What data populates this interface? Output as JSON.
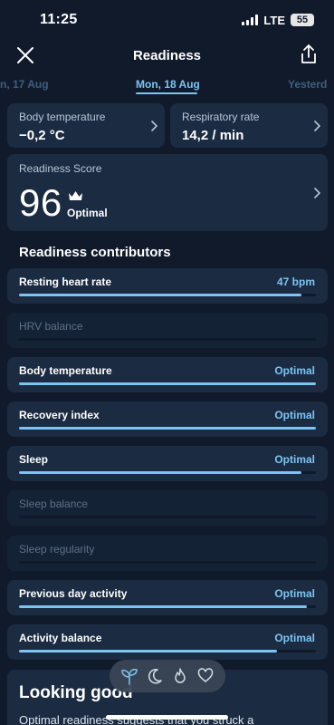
{
  "status_bar": {
    "time": "11:25",
    "network": "LTE",
    "battery": "55"
  },
  "header": {
    "title": "Readiness"
  },
  "dates": {
    "previous": "n, 17 Aug",
    "current": "Mon, 18 Aug",
    "next": "Yesterd"
  },
  "metrics": [
    {
      "label": "Body temperature",
      "value": "−0,2 °C"
    },
    {
      "label": "Respiratory rate",
      "value": "14,2 / min"
    }
  ],
  "score": {
    "label": "Readiness Score",
    "value": "96",
    "status": "Optimal"
  },
  "contributors_title": "Readiness contributors",
  "contributors": [
    {
      "label": "Resting heart rate",
      "value": "47 bpm",
      "progress": 0.95,
      "active": true
    },
    {
      "label": "HRV balance",
      "value": "",
      "progress": 0,
      "active": false
    },
    {
      "label": "Body temperature",
      "value": "Optimal",
      "progress": 1.0,
      "active": true
    },
    {
      "label": "Recovery index",
      "value": "Optimal",
      "progress": 1.0,
      "active": true
    },
    {
      "label": "Sleep",
      "value": "Optimal",
      "progress": 0.95,
      "active": true
    },
    {
      "label": "Sleep balance",
      "value": "",
      "progress": 0,
      "active": false
    },
    {
      "label": "Sleep regularity",
      "value": "",
      "progress": 0,
      "active": false
    },
    {
      "label": "Previous day activity",
      "value": "Optimal",
      "progress": 0.97,
      "active": true
    },
    {
      "label": "Activity balance",
      "value": "Optimal",
      "progress": 0.87,
      "active": true
    }
  ],
  "summary": {
    "title": "Looking good",
    "body": "Optimal readiness suggests that you struck a"
  },
  "tabs": [
    "sprout-icon",
    "moon-icon",
    "flame-icon",
    "heart-icon"
  ],
  "colors": {
    "accent": "#7cc4f2",
    "background": "#101a2b",
    "card": "#1b2b42"
  }
}
